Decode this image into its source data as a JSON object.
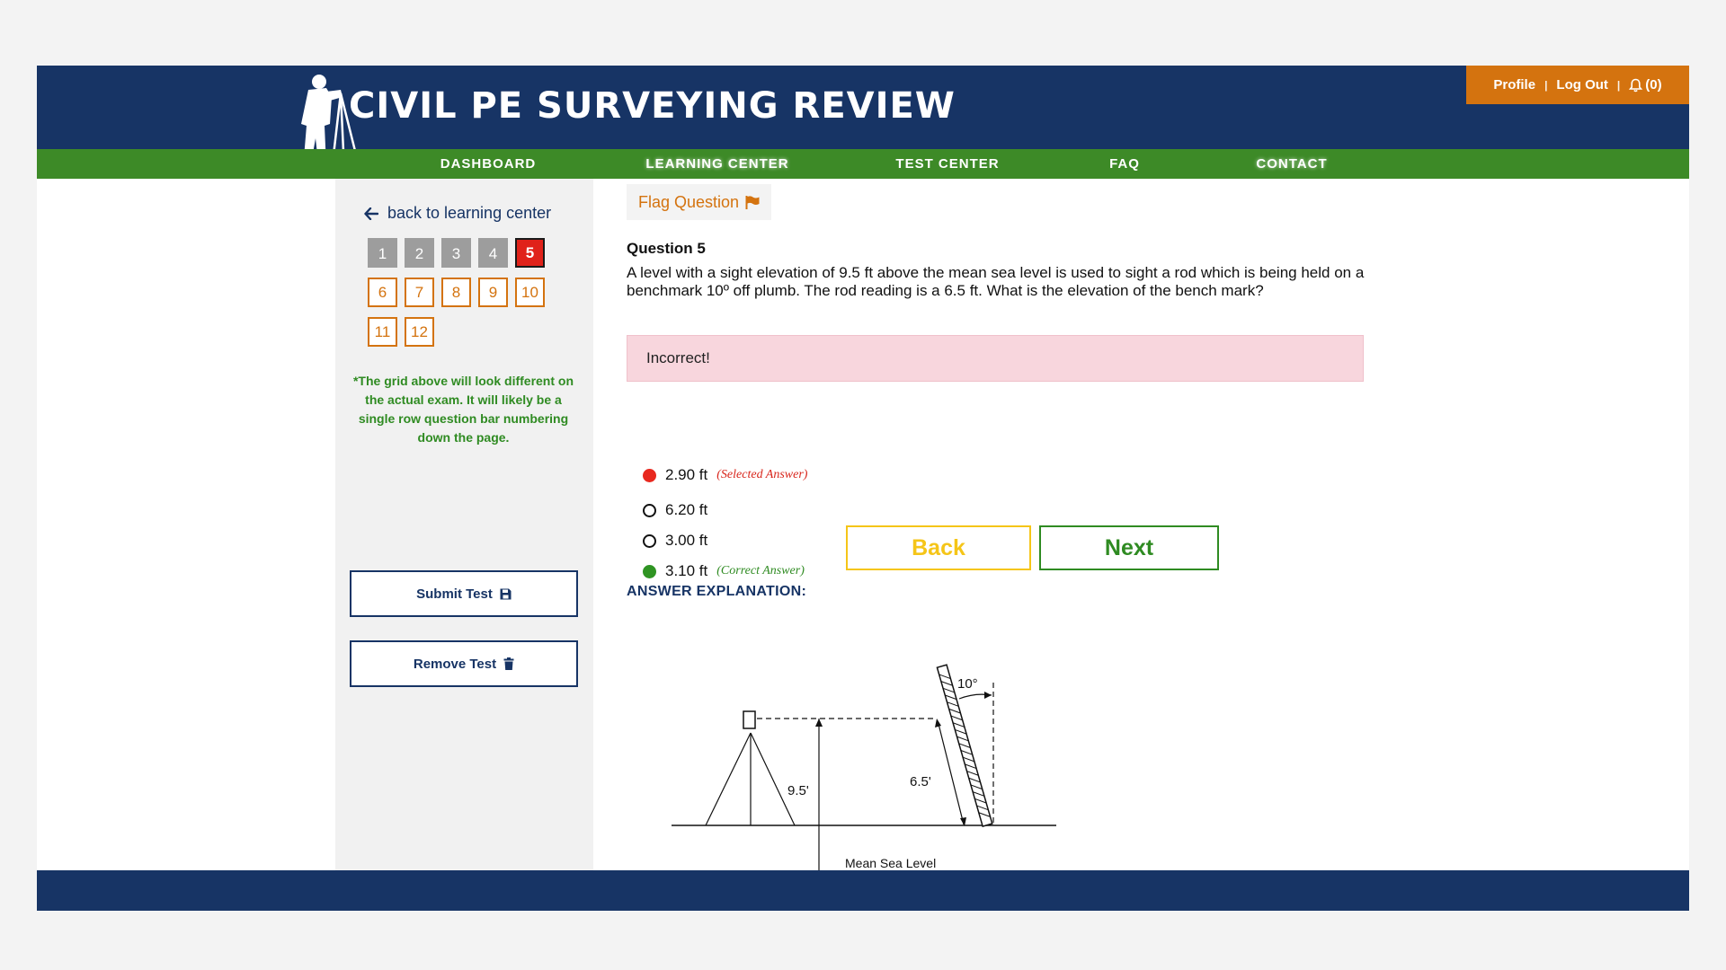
{
  "app": {
    "title": "CIVIL PE SURVEYING REVIEW",
    "colors": {
      "navy": "#173465",
      "green": "#3d8a27",
      "orange": "#d4730f",
      "red": "#e0221a",
      "yellow": "#f5c518"
    }
  },
  "account": {
    "profile": "Profile",
    "logout": "Log Out",
    "notifications": "(0)",
    "separator": "|"
  },
  "nav": {
    "items": [
      {
        "label": "DASHBOARD"
      },
      {
        "label": "LEARNING CENTER"
      },
      {
        "label": "TEST CENTER"
      },
      {
        "label": "FAQ"
      },
      {
        "label": "CONTACT"
      }
    ]
  },
  "sidebar": {
    "back_link": "back to learning center",
    "questions": [
      {
        "label": "1",
        "state": "answered"
      },
      {
        "label": "2",
        "state": "answered"
      },
      {
        "label": "3",
        "state": "answered"
      },
      {
        "label": "4",
        "state": "answered"
      },
      {
        "label": "5",
        "state": "current"
      },
      {
        "label": "6",
        "state": "pending"
      },
      {
        "label": "7",
        "state": "pending"
      },
      {
        "label": "8",
        "state": "pending"
      },
      {
        "label": "9",
        "state": "pending"
      },
      {
        "label": "10",
        "state": "pending"
      },
      {
        "label": "11",
        "state": "pending"
      },
      {
        "label": "12",
        "state": "pending"
      }
    ],
    "note": "*The grid above will look different on the actual exam. It will likely be a single row question bar numbering down the page.",
    "submit_label": "Submit Test",
    "remove_label": "Remove Test"
  },
  "question": {
    "flag_label": "Flag Question",
    "title": "Question 5",
    "text": "A level with a sight elevation of 9.5 ft above the mean sea level is used to sight a rod which is being held on a benchmark 10º off plumb. The rod reading is a 6.5 ft. What is the elevation of the bench mark?",
    "result": "Incorrect!",
    "options": [
      {
        "label": "2.90 ft",
        "tag": "(Selected Answer)",
        "state": "selected"
      },
      {
        "label": "6.20 ft",
        "tag": "",
        "state": "none"
      },
      {
        "label": "3.00 ft",
        "tag": "",
        "state": "none"
      },
      {
        "label": "3.10 ft",
        "tag": "(Correct Answer)",
        "state": "correct"
      }
    ],
    "back_label": "Back",
    "next_label": "Next",
    "explanation_title": "ANSWER EXPLANATION:"
  },
  "diagram": {
    "angle_label": "10°",
    "height_label": "9.5'",
    "rod_label": "6.5'",
    "datum_label": "Mean Sea Level"
  }
}
